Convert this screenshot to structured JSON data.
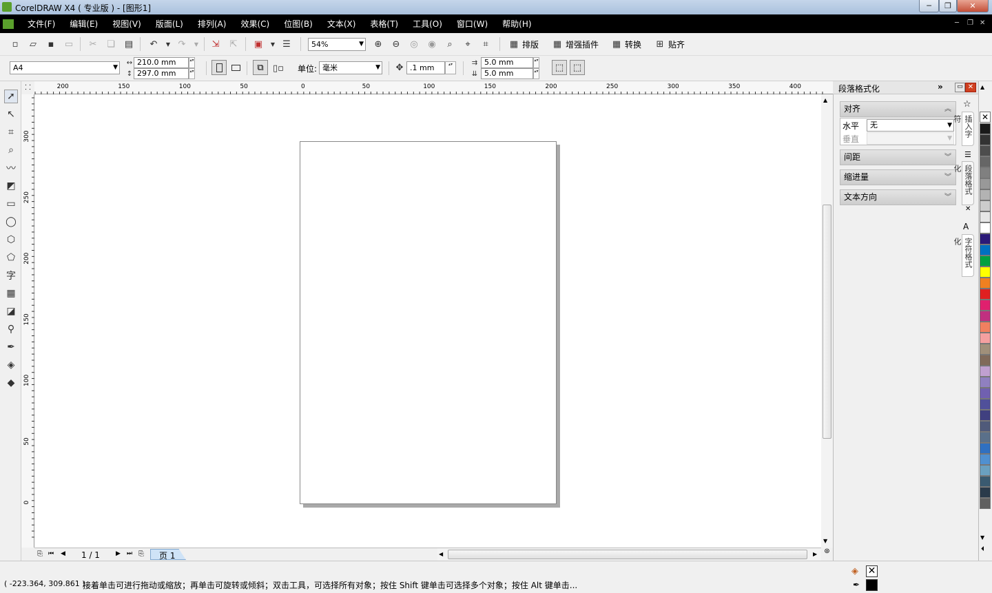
{
  "window": {
    "title": "CorelDRAW X4 ( 专业版 ) - [图形1]",
    "min": "─",
    "restore": "❐",
    "close": "✕"
  },
  "menu": [
    "文件(F)",
    "编辑(E)",
    "视图(V)",
    "版面(L)",
    "排列(A)",
    "效果(C)",
    "位图(B)",
    "文本(X)",
    "表格(T)",
    "工具(O)",
    "窗口(W)",
    "帮助(H)"
  ],
  "toolbar": {
    "zoom": "54%",
    "layout_label": "排版",
    "plugin_label": "增强插件",
    "convert_label": "转换",
    "snap_label": "贴齐"
  },
  "props": {
    "paper": "A4",
    "width": "210.0 mm",
    "height": "297.0 mm",
    "unit_label": "单位:",
    "unit": "毫米",
    "nudge": ".1 mm",
    "dup_x": "5.0 mm",
    "dup_y": "5.0 mm"
  },
  "ruler": {
    "h_labels": [
      "200",
      "150",
      "100",
      "50",
      "0",
      "50",
      "100",
      "150",
      "200",
      "250",
      "300",
      "350",
      "400"
    ],
    "v_labels": [
      "300",
      "250",
      "200",
      "150",
      "100",
      "50",
      "0"
    ]
  },
  "nav": {
    "page_count": "1 / 1",
    "page_tab": "页 1"
  },
  "status": {
    "coords": "( -223.364, 309.861 )",
    "hint": "接着单击可进行拖动或缩放；再单击可旋转或倾斜；双击工具，可选择所有对象；按住 Shift 键单击可选择多个对象；按住 Alt 键单击..."
  },
  "docker": {
    "title": "段落格式化",
    "align_label": "对齐",
    "horizontal_label": "水平",
    "horizontal_value": "无",
    "vertical_label": "垂直",
    "spacing_label": "间距",
    "indent_label": "缩进量",
    "direction_label": "文本方向",
    "tabs": [
      "插入字符",
      "段落格式化",
      "字符格式化"
    ]
  },
  "palette": [
    "#1a1a1a",
    "#333333",
    "#4d4d4d",
    "#666666",
    "#808080",
    "#999999",
    "#b3b3b3",
    "#cccccc",
    "#e6e6e6",
    "#ffffff",
    "#2b1a78",
    "#0070c0",
    "#00a040",
    "#ffff00",
    "#f08020",
    "#e02020",
    "#e0206e",
    "#c03080",
    "#f08060",
    "#f4a0a0",
    "#a0907a",
    "#806a5a",
    "#c0a0d0",
    "#9080c0",
    "#7060b0",
    "#50509a",
    "#404080",
    "#505a7a",
    "#5a708a",
    "#3070c0",
    "#5090d0",
    "#6aa0c0",
    "#3a5a70",
    "#2a3a4a",
    "#606060"
  ]
}
